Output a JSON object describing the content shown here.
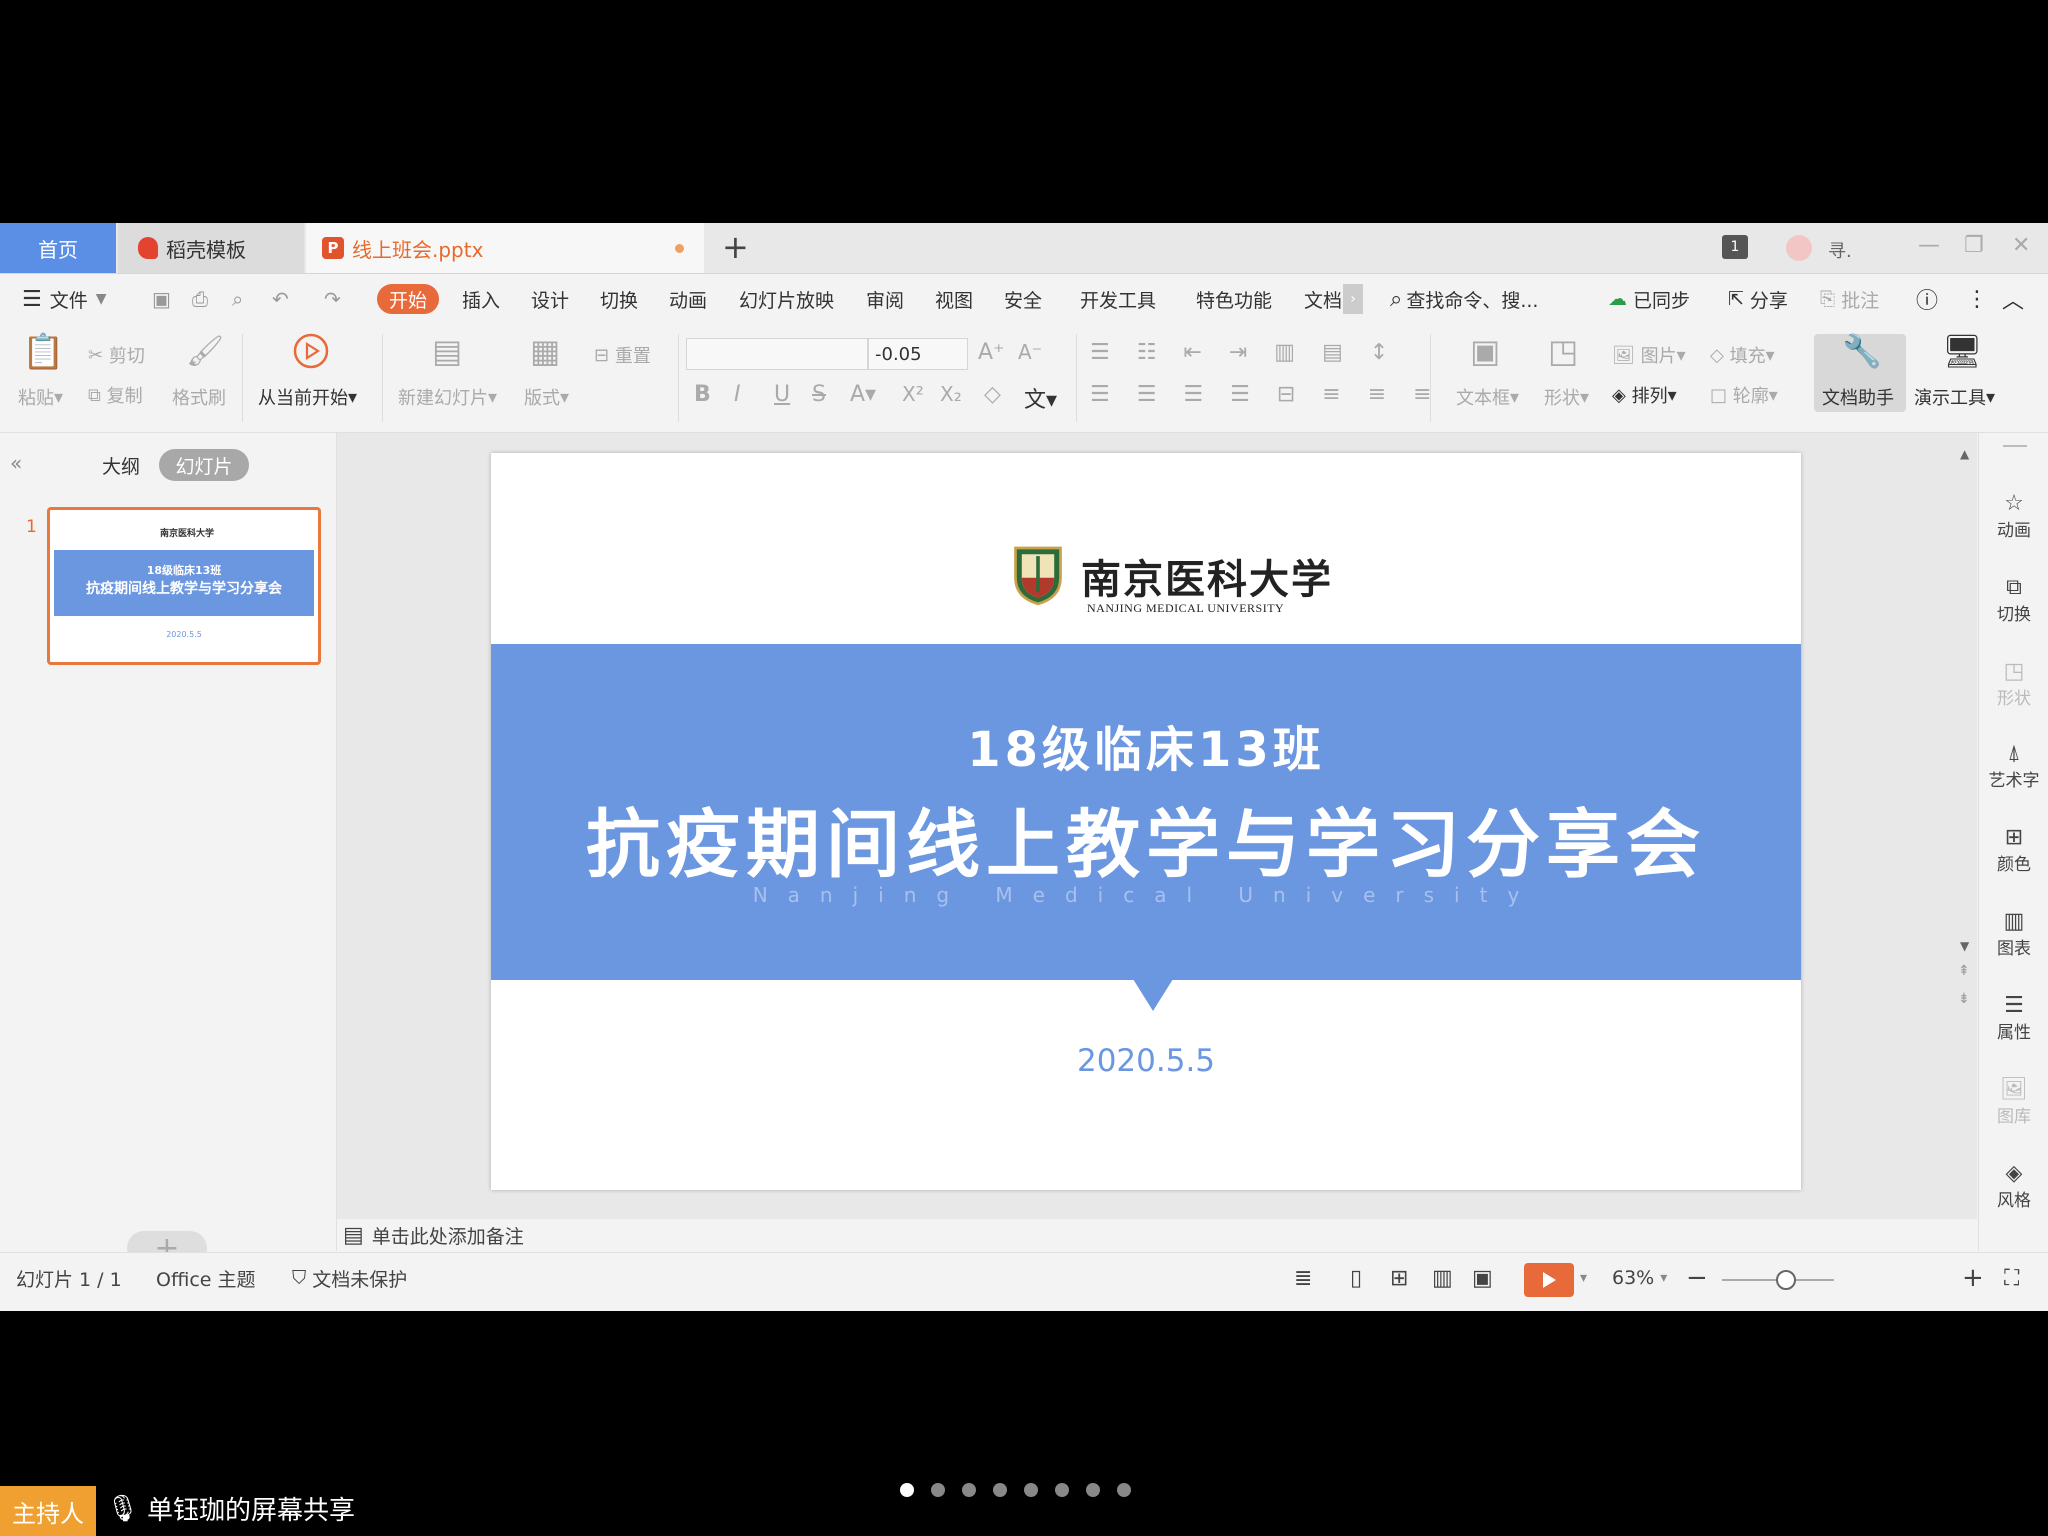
{
  "tabs": {
    "home": "首页",
    "daoke": "稻壳模板",
    "file": "线上班会.pptx",
    "count_badge": "1",
    "user": "寻."
  },
  "menu": {
    "file": "文件",
    "items": [
      "开始",
      "插入",
      "设计",
      "切换",
      "动画",
      "幻灯片放映",
      "审阅",
      "视图",
      "安全",
      "开发工具",
      "特色功能",
      "文档"
    ],
    "search": "查找命令、搜...",
    "synced": "已同步",
    "share": "分享",
    "comment": "批注"
  },
  "ribbon": {
    "paste": "粘贴",
    "cut": "剪切",
    "copy": "复制",
    "format_painter": "格式刷",
    "start_from_current": "从当前开始",
    "new_slide": "新建幻灯片",
    "layout": "版式",
    "reset": "重置",
    "font_size": "-0.05",
    "picture": "图片",
    "fill": "填充",
    "textbox": "文本框",
    "shape": "形状",
    "arrange": "排列",
    "outline": "轮廓",
    "doc_assistant": "文档助手",
    "presentation_tools": "演示工具"
  },
  "left_panel": {
    "outline_tab": "大纲",
    "slides_tab": "幻灯片",
    "slide_number": "1"
  },
  "slide": {
    "university_cn": "南京医科大学",
    "university_en": "NANJING MEDICAL UNIVERSITY",
    "subtitle": "18级临床13班",
    "title": "抗疫期间线上教学与学习分享会",
    "english": "Nanjing Medical University",
    "date": "2020.5.5",
    "colors": {
      "band": "#6b96e0",
      "date": "#6b96e0"
    }
  },
  "notes_placeholder": "单击此处添加备注",
  "right_bar": {
    "items": [
      "动画",
      "切换",
      "形状",
      "艺术字",
      "颜色",
      "图表",
      "属性",
      "图库",
      "风格"
    ]
  },
  "status": {
    "slide_info": "幻灯片 1 / 1",
    "theme": "Office 主题",
    "protection": "文档未保护",
    "zoom": "63%"
  },
  "overlay": {
    "host": "主持人",
    "screen_share": "单钰珈的屏幕共享",
    "page_dots": 8,
    "active_dot": 1
  }
}
